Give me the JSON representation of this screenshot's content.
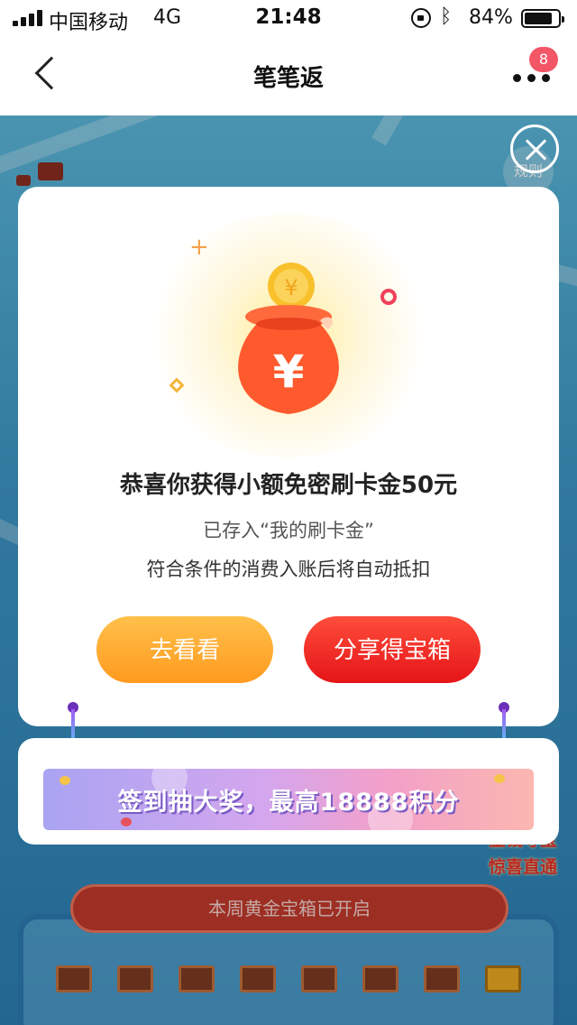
{
  "status_bar": {
    "carrier": "中国移动",
    "network": "4G",
    "time": "21:48",
    "battery": "84%",
    "battery_level": 0.84
  },
  "nav": {
    "title": "笔笔返",
    "badge": "8"
  },
  "scene": {
    "rules_tab": "规则",
    "week_banner": "本周黄金宝箱已开启",
    "promo_line1": "金钱夺宝",
    "promo_line2": "惊喜直通"
  },
  "modal": {
    "title": "恭喜你获得小额免密刷卡金50元",
    "subtitle1": "已存入“我的刷卡金”",
    "subtitle2": "符合条件的消费入账后将自动抵扣",
    "button_look": "去看看",
    "button_share": "分享得宝箱"
  },
  "promo": {
    "banner_text": "签到抽大奖，最高18888积分"
  },
  "colors": {
    "accent_red": "#e51418",
    "accent_orange": "#ff9a1f",
    "badge_red": "#f25667"
  },
  "icons": [
    "back-icon",
    "more-icon",
    "close-icon",
    "money-bag-icon",
    "bluetooth-icon",
    "rotation-lock-icon",
    "battery-icon",
    "signal-icon"
  ]
}
